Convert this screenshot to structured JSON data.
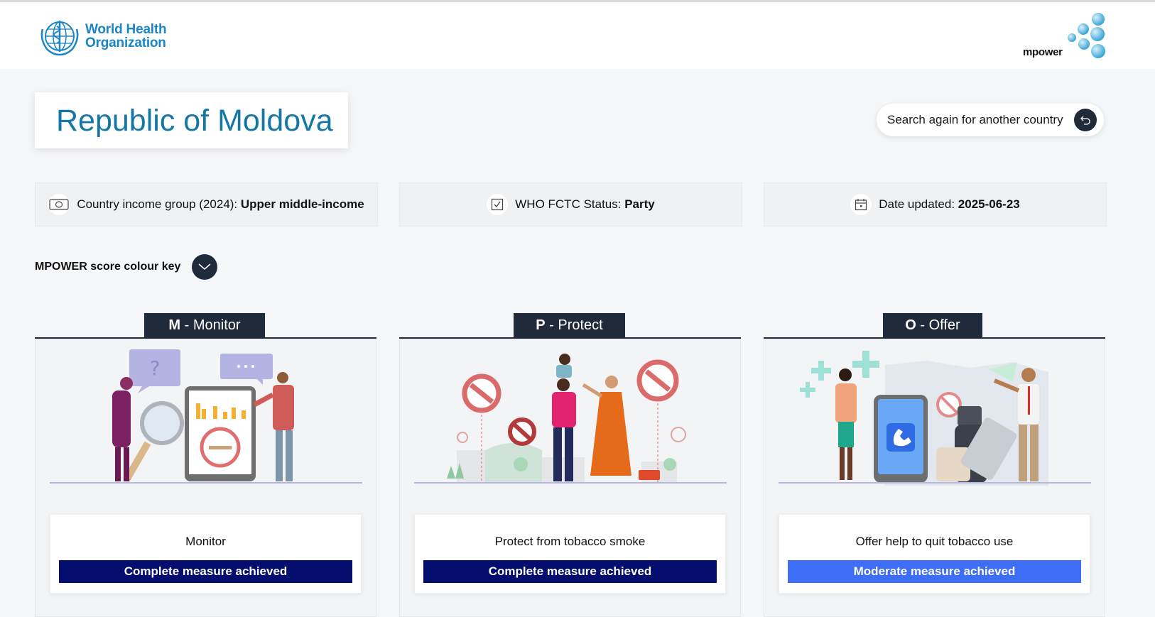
{
  "header": {
    "who_logo_line1": "World Health",
    "who_logo_line2": "Organization",
    "mpower_logo_text": "mpower"
  },
  "country": {
    "name": "Republic of Moldova"
  },
  "search_again": {
    "label": "Search again for another country",
    "icon": "return-arrow-icon"
  },
  "info": [
    {
      "label": "Country income group (2024): ",
      "value": "Upper middle-income",
      "icon": "banknote-icon"
    },
    {
      "label": "WHO FCTC Status: ",
      "value": "Party",
      "icon": "checkbox-icon"
    },
    {
      "label": "Date updated: ",
      "value": "2025-06-23",
      "icon": "calendar-icon"
    }
  ],
  "colour_key": {
    "label": "MPOWER score colour key",
    "icon": "chevron-down-icon"
  },
  "columns": [
    {
      "letter": "M",
      "tab_suffix": " - Monitor",
      "card_title": "Monitor",
      "status": "Complete measure achieved",
      "status_color": "#020d6e",
      "illustration": "monitor-illustration"
    },
    {
      "letter": "P",
      "tab_suffix": " - Protect",
      "card_title": "Protect from tobacco smoke",
      "status": "Complete measure achieved",
      "status_color": "#020d6e",
      "illustration": "protect-illustration"
    },
    {
      "letter": "O",
      "tab_suffix": " - Offer",
      "card_title": "Offer help to quit tobacco use",
      "status": "Moderate measure achieved",
      "status_color": "#3d6ef5",
      "illustration": "offer-illustration"
    }
  ],
  "colors": {
    "accent_title": "#1577a6",
    "dark_navy": "#1f2b3a",
    "complete": "#020d6e",
    "moderate": "#3d6ef5"
  }
}
